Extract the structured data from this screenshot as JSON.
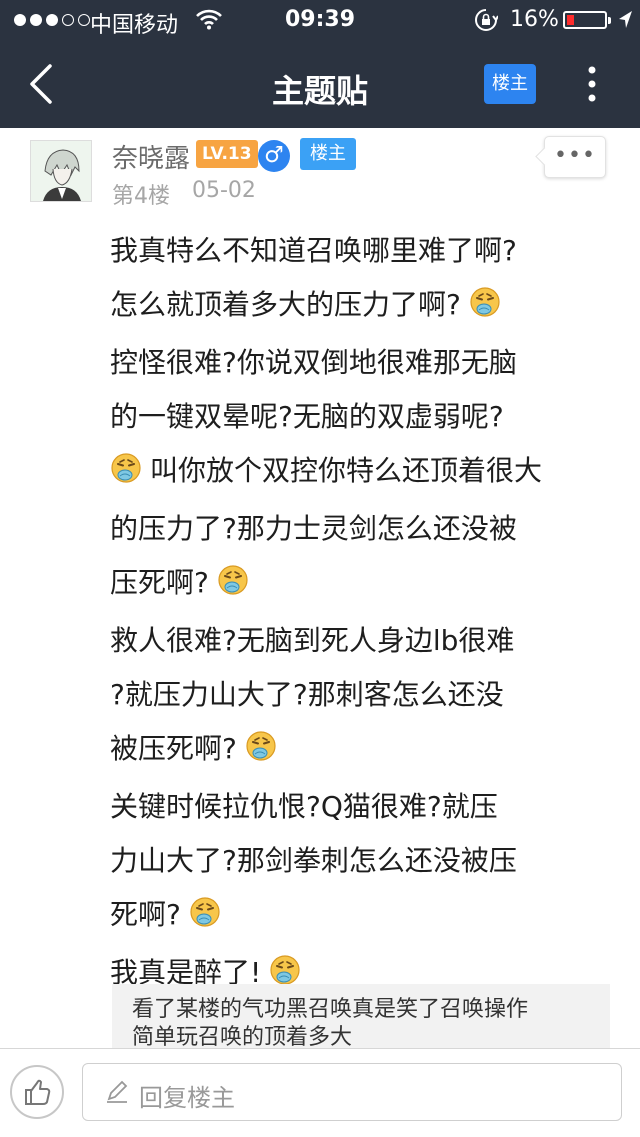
{
  "status_bar": {
    "carrier": "中国移动",
    "time": "09:39",
    "battery_percent": "16%",
    "battery_level": 0.16,
    "signal_bars_filled": 3,
    "signal_bars_total": 5
  },
  "navbar": {
    "title": "主题贴",
    "op_filter_label": "楼主",
    "icons": [
      "back-chevron-icon",
      "vertical-dots-icon"
    ]
  },
  "post": {
    "author_name": "奈晓露",
    "level_badge": "LV.13",
    "gender_symbol": "♂",
    "op_badge": "楼主",
    "floor": "第4楼",
    "date": "05-02",
    "more_label": "•••",
    "lines": [
      {
        "text": "我真特么不知道召唤哪里难了啊?",
        "emoji": false
      },
      {
        "text": "怎么就顶着多大的压力了啊?",
        "emoji": true
      },
      {
        "text": "控怪很难?你说双倒地很难那无脑",
        "emoji": false
      },
      {
        "text": "的一键双晕呢?无脑的双虚弱呢?",
        "emoji": false
      },
      {
        "text": "叫你放个双控你特么还顶着很大",
        "emoji_before": true
      },
      {
        "text": "的压力了?那力士灵剑怎么还没被",
        "emoji": false
      },
      {
        "text": "压死啊?",
        "emoji": true
      },
      {
        "text": "救人很难?无脑到死人身边lb很难",
        "emoji": false
      },
      {
        "text": "?就压力山大了?那刺客怎么还没",
        "emoji": false
      },
      {
        "text": "被压死啊?",
        "emoji": true
      },
      {
        "text": "关键时候拉仇恨?Q猫很难?就压",
        "emoji": false
      },
      {
        "text": "力山大了?那剑拳刺怎么还没被压",
        "emoji": false
      },
      {
        "text": "死啊?",
        "emoji": true
      },
      {
        "text": "我真是醉了!",
        "emoji": true
      }
    ],
    "emoji_name": "puking-face-emoji",
    "quote_lines": [
      "看了某楼的气功黑召唤真是笑了召唤操作",
      "简单玩召唤的顶着多大"
    ]
  },
  "bottom_bar": {
    "reply_placeholder": "回复楼主",
    "icons": [
      "thumbs-up-icon",
      "pencil-icon"
    ]
  },
  "colors": {
    "nav_bg": "#2b3340",
    "accent_blue": "#2d84f0",
    "level_orange": "#f7a442",
    "battery_red": "#ff2d2d"
  }
}
